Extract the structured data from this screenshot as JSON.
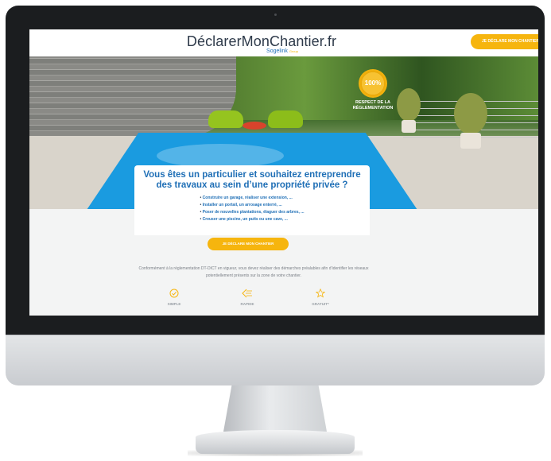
{
  "site": {
    "logo_main": "DéclarerMonChantier.fr",
    "logo_sub": "Sogelink",
    "logo_tag": "Group",
    "header_cta": "JE DÉCLARE MON CHANTIER"
  },
  "hero": {
    "badge_value": "100%",
    "badge_label": "RESPECT DE LA RÉGLEMENTATION",
    "title": "Vous êtes un particulier et souhaitez entreprendre des travaux au sein d’une propriété privée ?",
    "bullets": [
      "Construire un garage, réaliser une extension, ...",
      "Installer un portail, un arrosage enterré, ...",
      "Poser de nouvelles plantations, élaguer des arbres, ...",
      "Creuser une piscine, un puits ou une cave, ..."
    ],
    "cta": "JE DÉCLARE MON CHANTIER"
  },
  "info": {
    "text": "Conformément à la réglementation DT-DICT en vigueur, vous devez réaliser des démarches préalables afin d’identifier les réseaux potentiellement présents sur la zone de votre chantier."
  },
  "features": [
    {
      "icon": "check-circle-icon",
      "label": "SIMPLE"
    },
    {
      "icon": "fast-forward-icon",
      "label": "RAPIDE"
    },
    {
      "icon": "star-icon",
      "label": "GRATUIT*"
    }
  ],
  "colors": {
    "accent": "#f6b50e",
    "brand_blue": "#1f6fb6",
    "pool": "#1a9be0"
  }
}
